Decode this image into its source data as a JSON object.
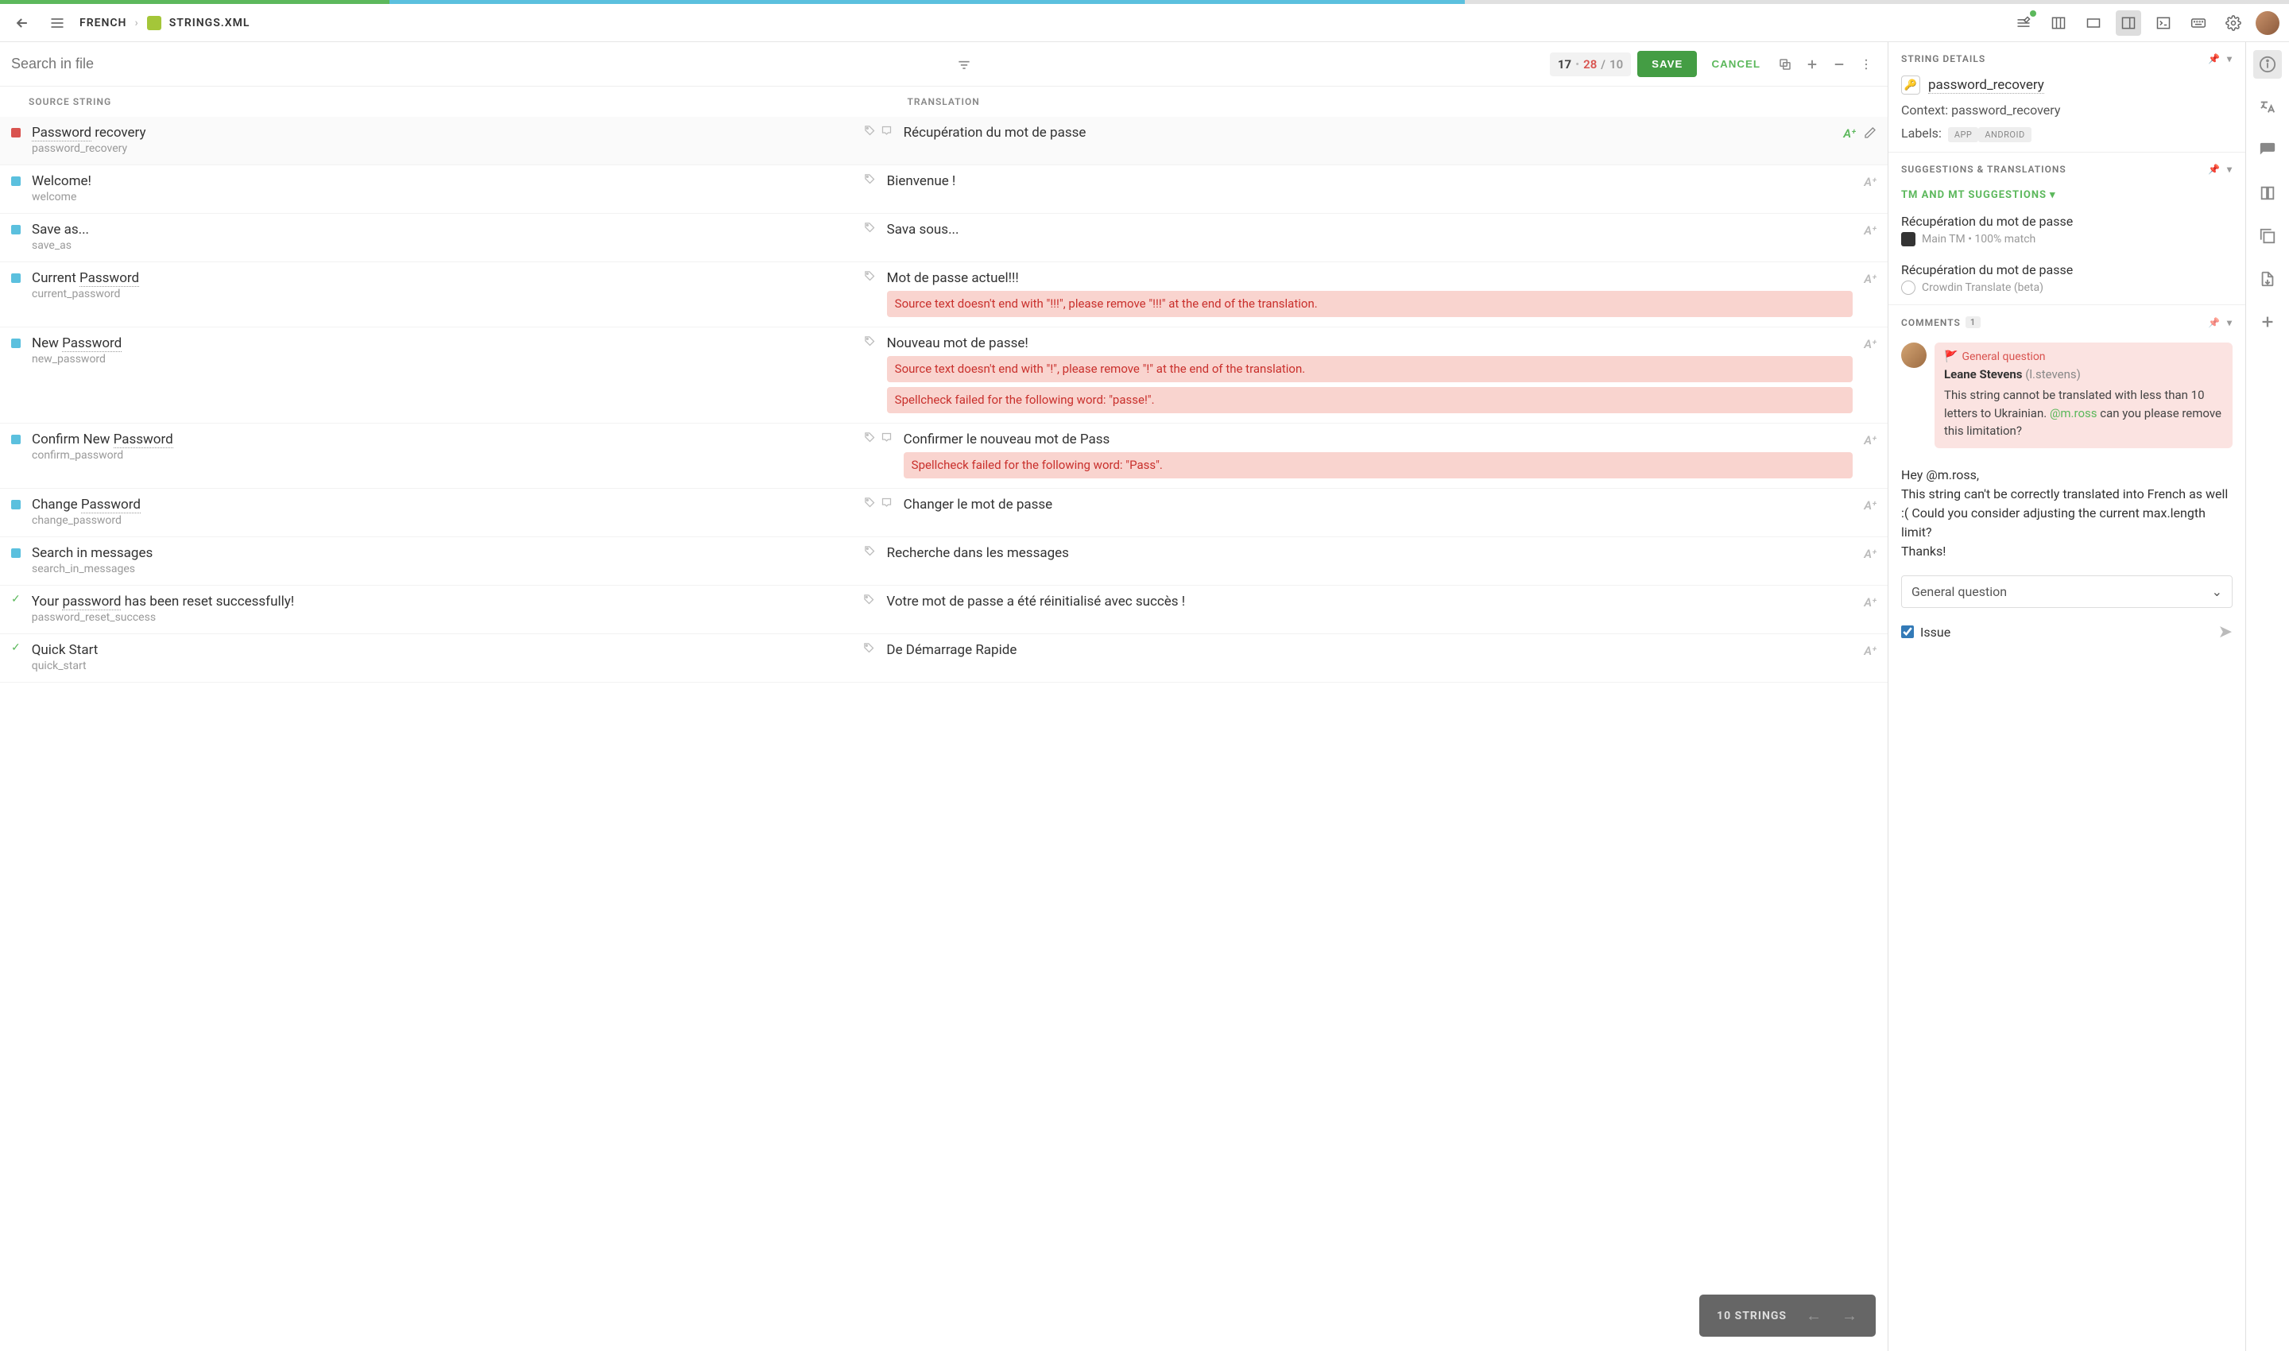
{
  "progress": {
    "green_pct": 17,
    "blue_pct": 47
  },
  "breadcrumb": {
    "lang": "FRENCH",
    "file": "STRINGS.XML"
  },
  "toolbar": {
    "search_placeholder": "Search in file",
    "counter_num": "17",
    "counter_red": "28",
    "counter_total": "10",
    "save": "SAVE",
    "cancel": "CANCEL"
  },
  "cols": {
    "src": "SOURCE STRING",
    "trans": "TRANSLATION"
  },
  "rows": [
    {
      "status": "red",
      "pre": "",
      "under": "Password",
      "post": " recovery",
      "key": "password_recovery",
      "tag": true,
      "comment": true,
      "trans": "Récupération du mot de passe",
      "ai_green": true,
      "edit": true,
      "warns": []
    },
    {
      "status": "blue",
      "pre": "Welcome!",
      "under": "",
      "post": "",
      "key": "welcome",
      "tag": true,
      "comment": false,
      "trans": "Bienvenue !",
      "ai_green": false,
      "edit": false,
      "warns": []
    },
    {
      "status": "blue",
      "pre": "Save as...",
      "under": "",
      "post": "",
      "key": "save_as",
      "tag": true,
      "comment": false,
      "trans": "Sava sous...",
      "ai_green": false,
      "edit": false,
      "warns": []
    },
    {
      "status": "blue",
      "pre": "Current ",
      "under": "Password",
      "post": "",
      "key": "current_password",
      "tag": true,
      "comment": false,
      "trans": "Mot de passe actuel!!!",
      "ai_green": false,
      "edit": false,
      "warns": [
        "Source text doesn't end with \"!!!\", please remove \"!!!\" at the end of the translation."
      ]
    },
    {
      "status": "blue",
      "pre": "New ",
      "under": "Password",
      "post": "",
      "key": "new_password",
      "tag": true,
      "comment": false,
      "trans": "Nouveau mot de passe!",
      "ai_green": false,
      "edit": false,
      "warns": [
        "Source text doesn't end with \"!\", please remove \"!\" at the end of the translation.",
        "Spellcheck failed for the following word: \"passe!\"."
      ]
    },
    {
      "status": "blue",
      "pre": "Confirm New ",
      "under": "Password",
      "post": "",
      "key": "confirm_password",
      "tag": true,
      "comment": true,
      "trans": "Confirmer le nouveau mot de Pass",
      "ai_green": false,
      "edit": false,
      "warns": [
        "Spellcheck failed for the following word: \"Pass\"."
      ]
    },
    {
      "status": "blue",
      "pre": "Change ",
      "under": "Password",
      "post": "",
      "key": "change_password",
      "tag": true,
      "comment": true,
      "trans": "Changer le mot de passe",
      "ai_green": false,
      "edit": false,
      "warns": []
    },
    {
      "status": "blue",
      "pre": "Search in messages",
      "under": "",
      "post": "",
      "key": "search_in_messages",
      "tag": true,
      "comment": false,
      "trans": "Recherche dans les messages",
      "ai_green": false,
      "edit": false,
      "warns": []
    },
    {
      "status": "green",
      "pre": "Your ",
      "under": "password",
      "post": " has been reset successfully!",
      "key": "password_reset_success",
      "tag": true,
      "comment": false,
      "trans": "Votre mot de passe a été réinitialisé avec succès !",
      "ai_green": false,
      "edit": false,
      "warns": []
    },
    {
      "status": "green",
      "pre": "Quick Start",
      "under": "",
      "post": "",
      "key": "quick_start",
      "tag": true,
      "comment": false,
      "trans": "De Démarrage Rapide",
      "ai_green": false,
      "edit": false,
      "warns": []
    }
  ],
  "bottom": {
    "label": "10 STRINGS"
  },
  "details": {
    "title": "STRING DETAILS",
    "key": "password_recovery",
    "context_label": "Context:",
    "context_val": "password_recovery",
    "labels_label": "Labels:",
    "labels": [
      "APP",
      "ANDROID"
    ]
  },
  "suggestions": {
    "title": "SUGGESTIONS & TRANSLATIONS",
    "sub": "TM AND MT SUGGESTIONS",
    "items": [
      {
        "text": "Récupération du mot de passe",
        "meta": "Main TM  •  100% match",
        "badge": "dark"
      },
      {
        "text": "Récupération du mot de passe",
        "meta": "Crowdin Translate (beta)",
        "badge": "outline"
      }
    ]
  },
  "comments": {
    "title": "COMMENTS",
    "count": "1",
    "item": {
      "tag": "General question",
      "author": "Leane Stevens",
      "handle": "(l.stevens)",
      "text_pre": "This string cannot be translated with less than 10 letters to Ukrainian. ",
      "mention": "@m.ross",
      "text_post": " can you please remove this limitation?"
    },
    "draft": "Hey @m.ross,\nThis string can't be correctly translated into French as well :( Could you consider adjusting the current max.length limit?\nThanks!",
    "select": "General question",
    "issue": "Issue"
  }
}
